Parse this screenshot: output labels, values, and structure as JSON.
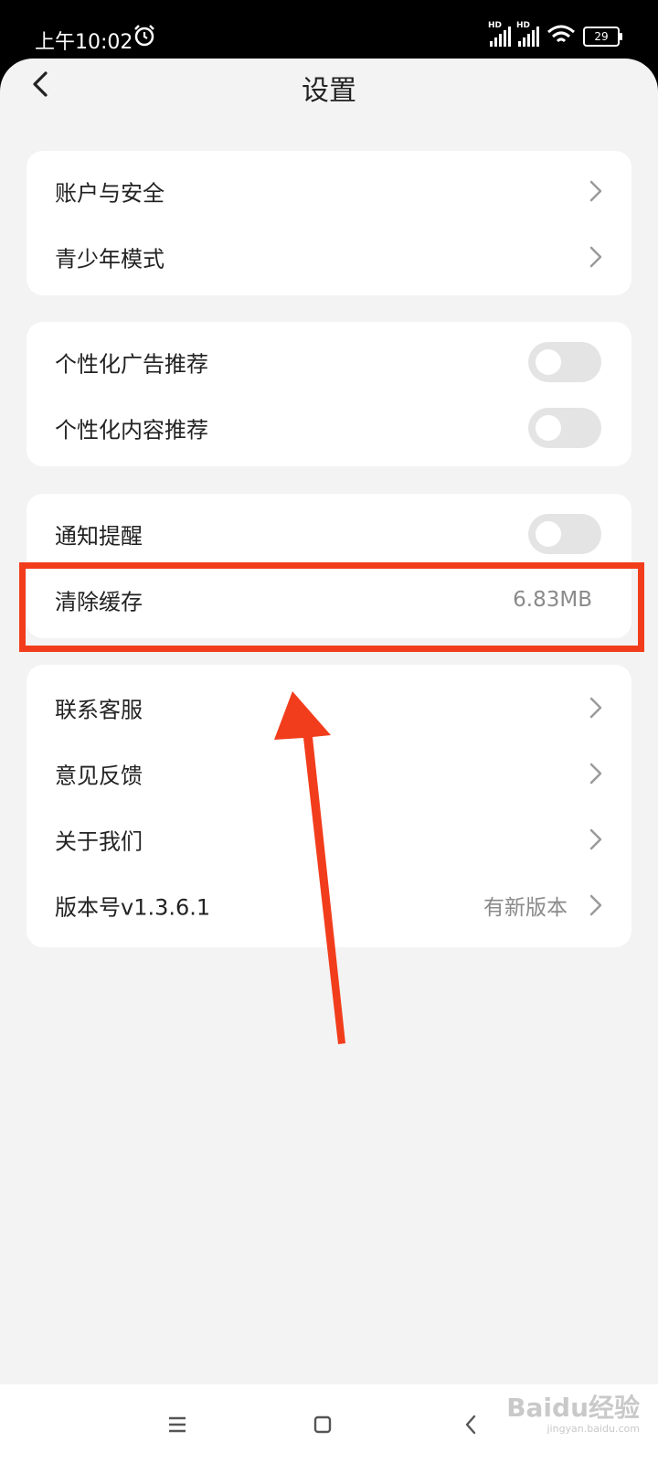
{
  "status_bar": {
    "time": "上午10:02",
    "battery": "29",
    "network_label": "HD",
    "wifi_sub": "6"
  },
  "header": {
    "title": "设置"
  },
  "groups": [
    {
      "rows": [
        {
          "label": "账户与安全",
          "control": "chevron"
        },
        {
          "label": "青少年模式",
          "control": "chevron"
        }
      ]
    },
    {
      "rows": [
        {
          "label": "个性化广告推荐",
          "control": "toggle",
          "state": "off"
        },
        {
          "label": "个性化内容推荐",
          "control": "toggle",
          "state": "off"
        }
      ]
    },
    {
      "rows": [
        {
          "label": "通知提醒",
          "control": "toggle",
          "state": "off"
        },
        {
          "label": "清除缓存",
          "control": "value",
          "value": "6.83MB"
        }
      ]
    },
    {
      "rows": [
        {
          "label": "联系客服",
          "control": "chevron"
        },
        {
          "label": "意见反馈",
          "control": "chevron"
        },
        {
          "label": "关于我们",
          "control": "chevron"
        },
        {
          "label": "版本号v1.3.6.1",
          "control": "value-chevron",
          "value": "有新版本"
        }
      ]
    }
  ],
  "annotation": {
    "color": "#f23d1c"
  },
  "watermark": {
    "brand": "Baidu经验",
    "url": "jingyan.baidu.com"
  },
  "colors": {
    "background": "#f3f3f3",
    "card": "#ffffff",
    "toggle_off": "#e4e4e4",
    "secondary_text": "#8a8a8a"
  },
  "icons": [
    "back-arrow-icon",
    "chevron-right-icon",
    "alarm-icon",
    "signal-icon",
    "wifi-icon",
    "battery-icon",
    "menu-icon",
    "home-icon",
    "back-nav-icon"
  ]
}
